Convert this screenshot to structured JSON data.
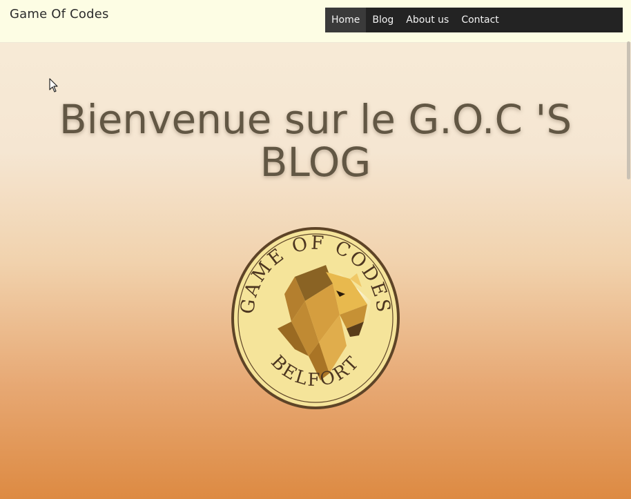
{
  "header": {
    "brand": "Game Of Codes"
  },
  "nav": {
    "items": [
      {
        "label": "Home",
        "active": true
      },
      {
        "label": "Blog",
        "active": false
      },
      {
        "label": "About us",
        "active": false
      },
      {
        "label": "Contact",
        "active": false
      }
    ]
  },
  "hero": {
    "title": "Bienvenue sur le G.O.C 'S BLOG"
  },
  "logo": {
    "top_text": "GAME OF CODES",
    "bottom_text": "BELFORT"
  },
  "colors": {
    "topbar_bg": "#fdfde4",
    "nav_bg": "#232323",
    "title_color": "#625744",
    "logo_fill": "#f5e49a",
    "logo_border": "#5e4427"
  }
}
